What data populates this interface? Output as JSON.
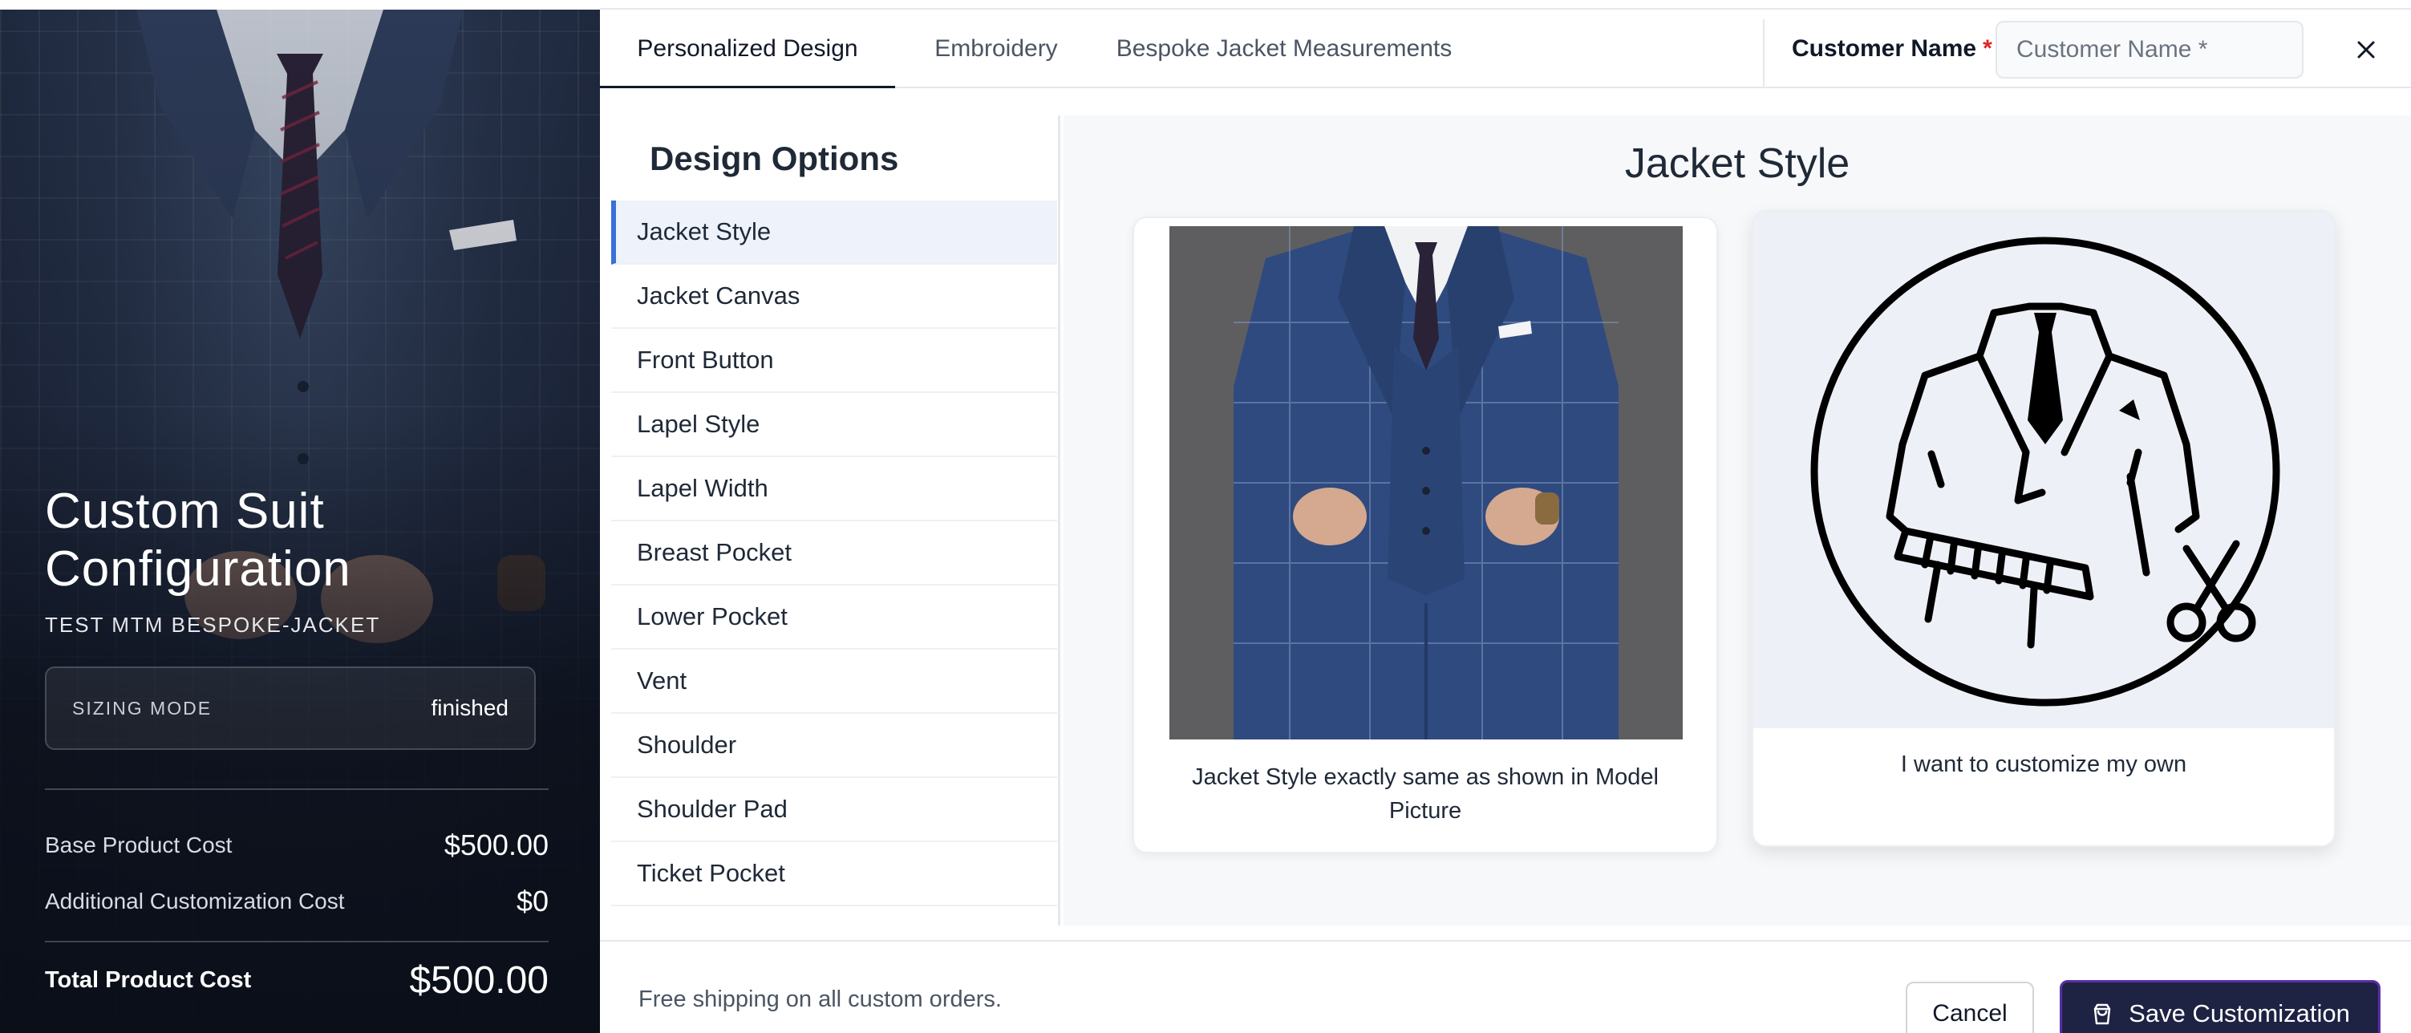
{
  "hero": {
    "title_line1": "Custom Suit",
    "title_line2": "Configuration",
    "subtitle": "TEST MTM BESPOKE-JACKET",
    "sizing_label": "SIZING MODE",
    "sizing_value": "finished",
    "base_cost_label": "Base Product Cost",
    "base_cost_value": "$500.00",
    "additional_cost_label": "Additional Customization Cost",
    "additional_cost_value": "$0",
    "total_label": "Total Product Cost",
    "total_value": "$500.00"
  },
  "tabs": [
    {
      "label": "Personalized Design",
      "active": true
    },
    {
      "label": "Embroidery",
      "active": false
    },
    {
      "label": "Bespoke Jacket Measurements",
      "active": false
    }
  ],
  "customer": {
    "label": "Customer Name",
    "required_mark": "*",
    "input_value": "",
    "input_placeholder": "Customer Name *"
  },
  "options_panel": {
    "title": "Design Options",
    "items": [
      {
        "label": "Jacket Style",
        "active": true
      },
      {
        "label": "Jacket Canvas"
      },
      {
        "label": "Front Button"
      },
      {
        "label": "Lapel Style"
      },
      {
        "label": "Lapel Width"
      },
      {
        "label": "Breast Pocket"
      },
      {
        "label": "Lower Pocket"
      },
      {
        "label": "Vent"
      },
      {
        "label": "Shoulder"
      },
      {
        "label": "Shoulder Pad"
      },
      {
        "label": "Ticket Pocket"
      }
    ]
  },
  "detail": {
    "title": "Jacket Style",
    "cards": [
      {
        "caption": "Jacket Style exactly same as shown in Model Picture",
        "image": "model-suit-photo"
      },
      {
        "caption": "I want to customize my own",
        "image": "jacket-scissors-icon"
      }
    ]
  },
  "footer": {
    "shipping_note": "Free shipping on all custom orders.",
    "cancel_label": "Cancel",
    "save_label": "Save Customization",
    "save_icon": "shopping-bag-icon"
  },
  "colors": {
    "accent_blue": "#3b6fd9",
    "save_bg": "#1e2343",
    "save_border": "#5b2da8",
    "required_red": "#dc2626"
  }
}
